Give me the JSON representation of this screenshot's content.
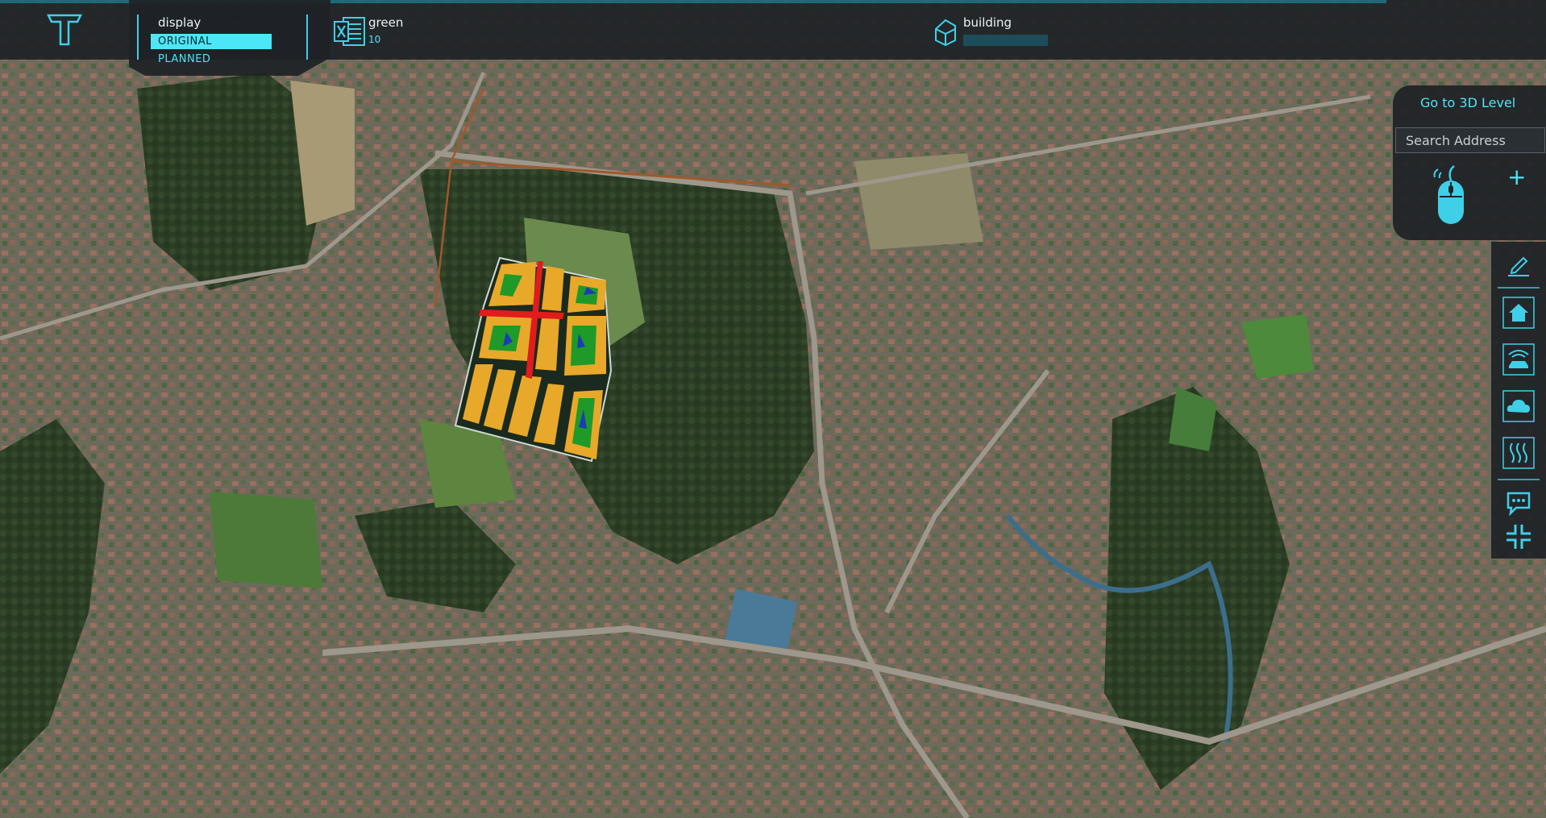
{
  "topbar": {
    "display": {
      "label": "display",
      "options": [
        "ORIGINAL",
        "PLANNED"
      ],
      "selected": "ORIGINAL"
    },
    "indicator_green": {
      "label": "green",
      "value": "10",
      "icon": "excel-icon"
    },
    "indicator_building": {
      "label": "building",
      "icon": "building-icon"
    }
  },
  "right_panel": {
    "go_3d_label": "Go to 3D Level",
    "search_placeholder": "Search Address",
    "mouse_icon": "mouse-icon",
    "plus_label": "+"
  },
  "toolbar": {
    "tools": [
      "edit-icon",
      "house-icon",
      "traffic-icon",
      "cloud-icon",
      "heat-icon",
      "chat-icon",
      "collapse-icon"
    ]
  },
  "colors": {
    "accent": "#4de6f6",
    "panel": "#1e2226",
    "plan_road": "#e01c1c",
    "plan_lot": "#e8a82a",
    "plan_green": "#1f9a28",
    "plan_water": "#1a3cb4"
  }
}
